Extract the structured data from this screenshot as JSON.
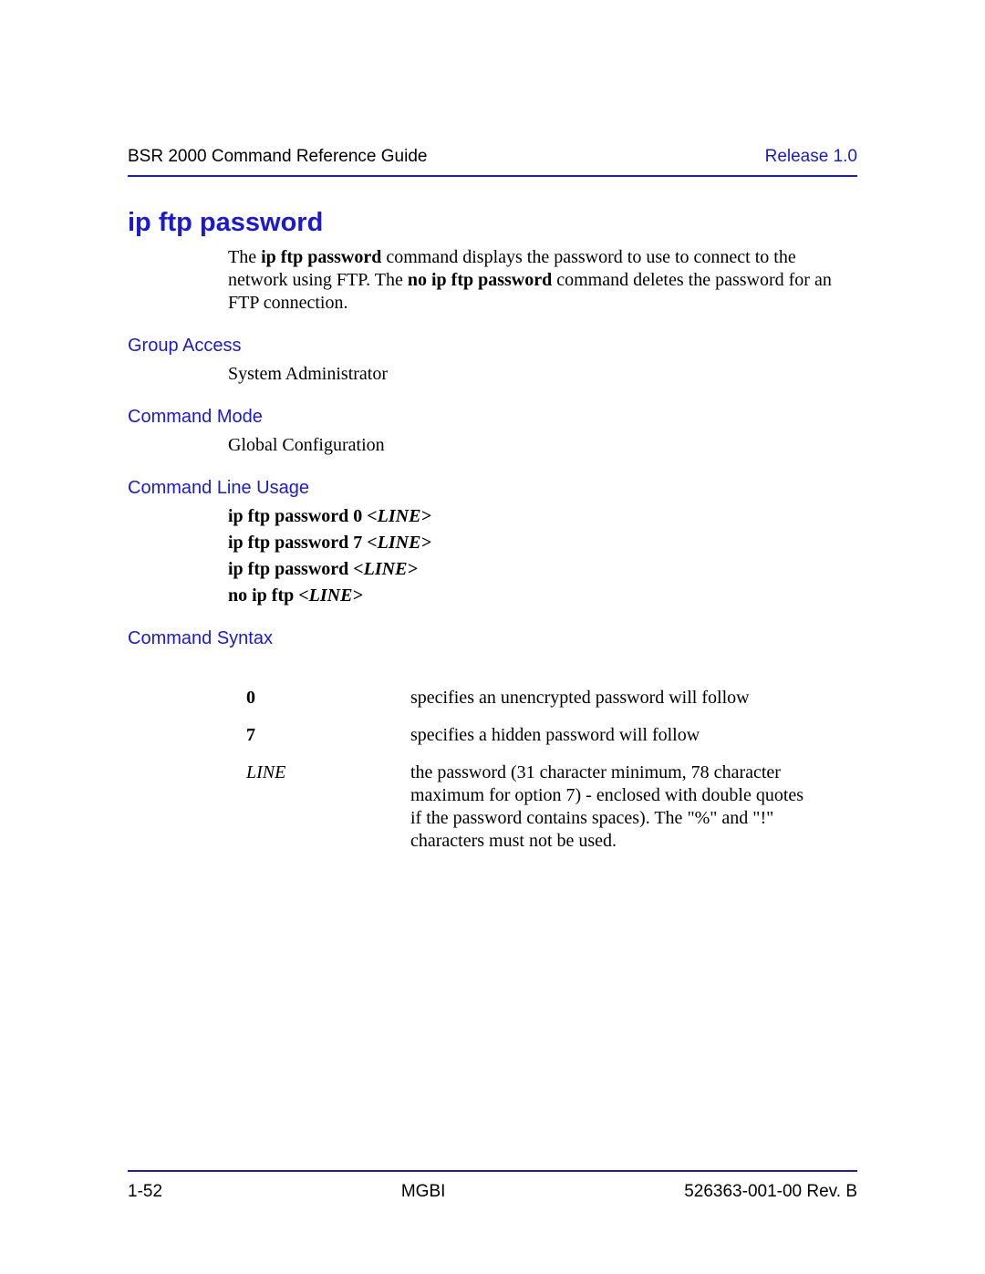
{
  "header": {
    "left": "BSR 2000 Command Reference Guide",
    "right": "Release 1.0"
  },
  "title": "ip ftp password",
  "intro": {
    "pre1": "The ",
    "b1": "ip ftp password",
    "mid1": " command displays the password to use to connect to the network using FTP. The ",
    "b2": "no ip ftp password",
    "post1": " command deletes the password for an FTP connection."
  },
  "sections": {
    "group_access": {
      "label": "Group Access",
      "value": "System Administrator"
    },
    "command_mode": {
      "label": "Command Mode",
      "value": "Global Configuration"
    },
    "usage_label": "Command Line Usage",
    "usage": [
      {
        "b": "ip ftp password 0 ",
        "i": "<LINE>"
      },
      {
        "b": "ip ftp password 7 ",
        "i": "<LINE>"
      },
      {
        "b": "ip ftp password ",
        "i": "<LINE>"
      },
      {
        "b": "no ip ftp ",
        "i": "<LINE>"
      }
    ],
    "syntax_label": "Command Syntax",
    "syntax": [
      {
        "key": "0",
        "italic": false,
        "desc": "specifies an unencrypted password will follow"
      },
      {
        "key": "7",
        "italic": false,
        "desc": "specifies a hidden password will follow"
      },
      {
        "key": "LINE",
        "italic": true,
        "desc": "the password (31 character minimum, 78 character maximum for option 7) - enclosed with double quotes if the password contains spaces). The \"%\" and \"!\" characters must not be used."
      }
    ]
  },
  "footer": {
    "left": "1-52",
    "center": "MGBI",
    "right": "526363-001-00 Rev. B"
  }
}
